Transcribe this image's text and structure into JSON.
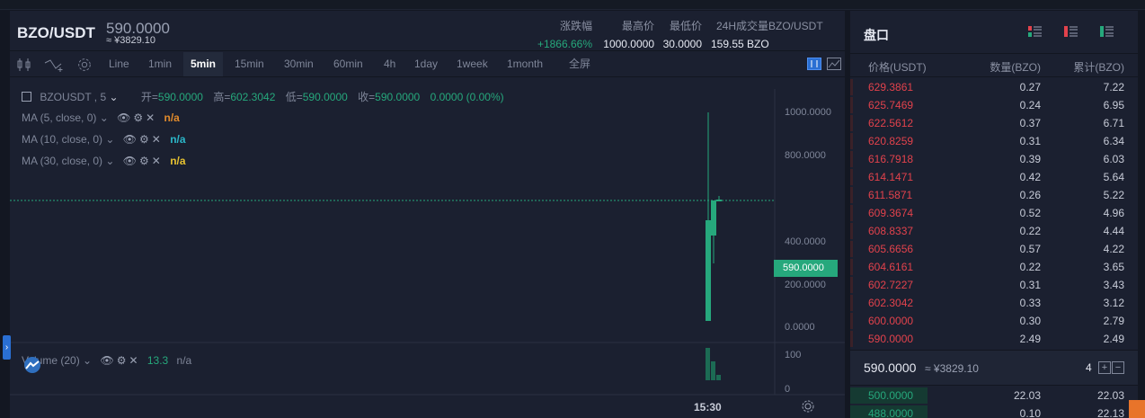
{
  "ticker": {
    "pair": "BZO/USDT",
    "last_price": "590.0000",
    "cny_price": "≈ ¥3829.10",
    "change_label": "涨跌幅",
    "change_value": "+1866.66%",
    "high_label": "最高价",
    "high_value": "1000.0000",
    "low_label": "最低价",
    "low_value": "30.0000",
    "volume_label": "24H成交量BZO/USDT",
    "volume_value": "159.55 BZO"
  },
  "toolbar": {
    "intervals": [
      "Line",
      "1min",
      "5min",
      "15min",
      "30min",
      "60min",
      "4h",
      "1day",
      "1week",
      "1month"
    ],
    "active_interval": "5min",
    "fullscreen": "全屏"
  },
  "chart": {
    "symbol_label": "BZOUSDT , 5",
    "ohlc": {
      "open_label": "开=",
      "open": "590.0000",
      "high_label": "高=",
      "high": "602.3042",
      "low_label": "低=",
      "low": "590.0000",
      "close_label": "收=",
      "close": "590.0000",
      "change": "0.0000 (0.00%)"
    },
    "indicators": [
      {
        "label": "MA (5, close, 0)",
        "value": "n/a",
        "color": "#e08a2c"
      },
      {
        "label": "MA (10, close, 0)",
        "value": "n/a",
        "color": "#2bb7c9"
      },
      {
        "label": "MA (30, close, 0)",
        "value": "n/a",
        "color": "#e7c230"
      }
    ],
    "volume_indicator": {
      "label": "Volume (20)",
      "value1": "13.3",
      "value2": "n/a"
    },
    "price_axis": [
      "1000.0000",
      "800.0000",
      "400.0000",
      "200.0000",
      "0.0000"
    ],
    "current_price_tag": "590.0000",
    "volume_axis": [
      "100",
      "0"
    ],
    "time_label": "15:30"
  },
  "orderbook": {
    "title": "盘口",
    "col_price": "价格(USDT)",
    "col_qty": "数量(BZO)",
    "col_total": "累计(BZO)",
    "asks": [
      {
        "price": "629.3861",
        "qty": "0.27",
        "total": "7.22"
      },
      {
        "price": "625.7469",
        "qty": "0.24",
        "total": "6.95"
      },
      {
        "price": "622.5612",
        "qty": "0.37",
        "total": "6.71"
      },
      {
        "price": "620.8259",
        "qty": "0.31",
        "total": "6.34"
      },
      {
        "price": "616.7918",
        "qty": "0.39",
        "total": "6.03"
      },
      {
        "price": "614.1471",
        "qty": "0.42",
        "total": "5.64"
      },
      {
        "price": "611.5871",
        "qty": "0.26",
        "total": "5.22"
      },
      {
        "price": "609.3674",
        "qty": "0.52",
        "total": "4.96"
      },
      {
        "price": "608.8337",
        "qty": "0.22",
        "total": "4.44"
      },
      {
        "price": "605.6656",
        "qty": "0.57",
        "total": "4.22"
      },
      {
        "price": "604.6161",
        "qty": "0.22",
        "total": "3.65"
      },
      {
        "price": "602.7227",
        "qty": "0.31",
        "total": "3.43"
      },
      {
        "price": "602.3042",
        "qty": "0.33",
        "total": "3.12"
      },
      {
        "price": "600.0000",
        "qty": "0.30",
        "total": "2.79"
      },
      {
        "price": "590.0000",
        "qty": "2.49",
        "total": "2.49"
      }
    ],
    "mid_price": "590.0000",
    "mid_cny": "≈ ¥3829.10",
    "precision": "4",
    "bids": [
      {
        "price": "500.0000",
        "qty": "22.03",
        "total": "22.03"
      },
      {
        "price": "488.0000",
        "qty": "0.10",
        "total": "22.13"
      }
    ]
  },
  "colors": {
    "up": "#26a87c",
    "down": "#e2424c",
    "accent": "#2a6fd3"
  }
}
